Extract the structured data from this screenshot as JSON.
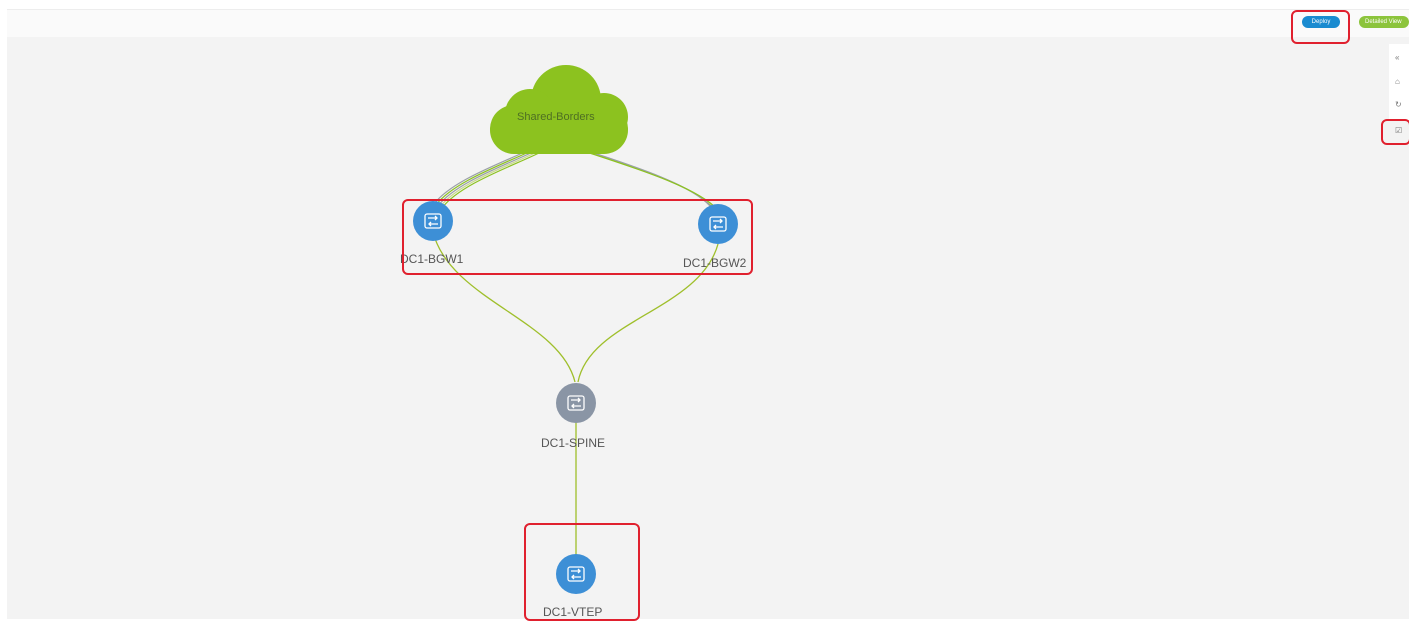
{
  "toolbar": {
    "deploy_label": "Deploy",
    "detailed_view_label": "Detailed View"
  },
  "side_tools": [
    {
      "icon": "back-icon",
      "glyph": "«"
    },
    {
      "icon": "home-icon",
      "glyph": "⌂"
    },
    {
      "icon": "refresh-icon",
      "glyph": "↻"
    },
    {
      "icon": "check-icon",
      "glyph": "☑"
    }
  ],
  "topology": {
    "cloud": {
      "label": "Shared-Borders",
      "color": "#8cc21f"
    },
    "nodes": [
      {
        "id": "DC1-BGW1",
        "label": "DC1-BGW1",
        "color": "#3d8fd6"
      },
      {
        "id": "DC1-BGW2",
        "label": "DC1-BGW2",
        "color": "#3d8fd6"
      },
      {
        "id": "DC1-SPINE",
        "label": "DC1-SPINE",
        "color": "#8a95a5"
      },
      {
        "id": "DC1-VTEP",
        "label": "DC1-VTEP",
        "color": "#3d8fd6"
      }
    ],
    "link_color": "#9fbf2b"
  },
  "colors": {
    "highlight": "#e0202e",
    "deploy": "#1a8bd0",
    "detailed_view": "#8cc43c"
  }
}
